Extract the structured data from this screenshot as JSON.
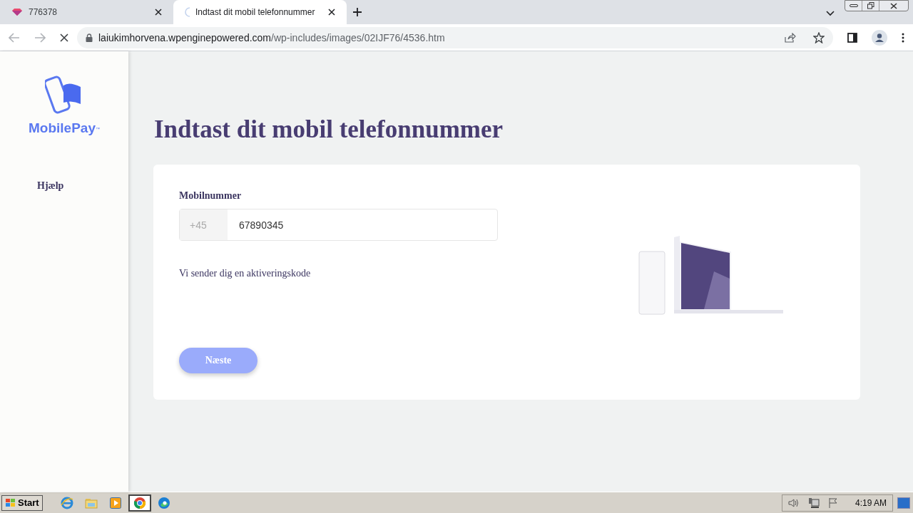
{
  "browser": {
    "tabs": [
      {
        "title": "776378",
        "selected": false,
        "loading": false
      },
      {
        "title": "Indtast dit mobil telefonnummer",
        "selected": true,
        "loading": true
      }
    ],
    "url": {
      "host": "laiukimhorvena.wpenginepowered.com",
      "path": "/wp-includes/images/02IJF76/4536.htm"
    }
  },
  "sidebar": {
    "logo_text": "MobilePay",
    "logo_mark": "™",
    "items": [
      "Hjælp"
    ]
  },
  "heading": "Indtast dit mobil telefonnummer",
  "form": {
    "label": "Mobilnummer",
    "prefix": "+45",
    "value": "67890345",
    "hint": "Vi sender dig en aktiveringskode",
    "button": {
      "label": "Næste",
      "disabled": true
    }
  },
  "taskbar": {
    "start": "Start",
    "apps": [
      {
        "kind": "ie",
        "selected": false
      },
      {
        "kind": "folder",
        "selected": false
      },
      {
        "kind": "media",
        "selected": false
      },
      {
        "kind": "chrome",
        "selected": true
      },
      {
        "kind": "edge",
        "selected": false
      }
    ],
    "clock": "4:19 AM"
  }
}
